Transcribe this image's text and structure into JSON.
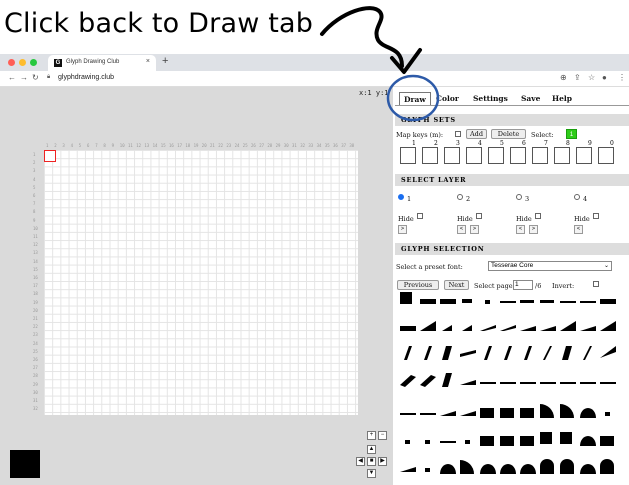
{
  "annotation": {
    "caption": "Click back to Draw tab"
  },
  "browser": {
    "tab_title": "Glyph Drawing Club",
    "favicon": "G",
    "close": "×",
    "new_tab": "+",
    "url": "glyphdrawing.club",
    "back_icon": "arrow-left-icon",
    "forward_icon": "arrow-right-icon",
    "reload_icon": "reload-icon",
    "lock_icon": "lock-icon",
    "toolbar_icons": [
      "zoom-icon",
      "share-icon",
      "star-icon",
      "profile-icon",
      "menu-icon"
    ],
    "traffic_lights": [
      "#ff5f57",
      "#febc2e",
      "#28c840"
    ]
  },
  "canvas": {
    "coord_readout": "x:1 y:1",
    "columns": [
      "1",
      "2",
      "3",
      "4",
      "5",
      "6",
      "7",
      "8",
      "9",
      "10",
      "11",
      "12",
      "13",
      "14",
      "15",
      "16",
      "17",
      "18",
      "19",
      "20",
      "21",
      "22",
      "23",
      "24",
      "25",
      "26",
      "27",
      "28",
      "29",
      "30",
      "31",
      "32",
      "33",
      "34",
      "35",
      "36",
      "37",
      "38"
    ],
    "rows": [
      "1",
      "2",
      "3",
      "4",
      "5",
      "6",
      "7",
      "8",
      "9",
      "10",
      "11",
      "12",
      "13",
      "14",
      "15",
      "16",
      "17",
      "18",
      "19",
      "20",
      "21",
      "22",
      "23",
      "24",
      "25",
      "26",
      "27",
      "28",
      "29",
      "30",
      "31",
      "32"
    ],
    "selected_color": "#000000",
    "zoom_in": "+",
    "zoom_out": "−",
    "pad_up": "▲",
    "pad_left": "◀",
    "pad_center": "■",
    "pad_right": "▶",
    "pad_down": "▼"
  },
  "panel": {
    "tabs": [
      "Draw",
      "Color",
      "Settings",
      "Save",
      "Help"
    ],
    "active_tab": "Draw",
    "glyph_sets": {
      "heading": "GLYPH SETS",
      "map_keys_label": "Map keys (m):",
      "add_label": "Add",
      "delete_label": "Delete",
      "select_label": "Select:",
      "selected_set": "1",
      "key_numbers": [
        "1",
        "2",
        "3",
        "4",
        "5",
        "6",
        "7",
        "8",
        "9",
        "0"
      ]
    },
    "select_layer": {
      "heading": "SELECT LAYER",
      "layers": [
        "1",
        "2",
        "3",
        "4"
      ],
      "active_layer": "1",
      "hide_label": "Hide",
      "left_btn": "<",
      "right_btn": ">"
    },
    "glyph_selection": {
      "heading": "GLYPH SELECTION",
      "preset_label": "Select a preset font:",
      "preset_value": "Tesserae Core",
      "previous_label": "Previous",
      "next_label": "Next",
      "select_page_label": "Select page:",
      "page_value": "1",
      "page_total": "/6",
      "invert_label": "Invert:"
    }
  }
}
